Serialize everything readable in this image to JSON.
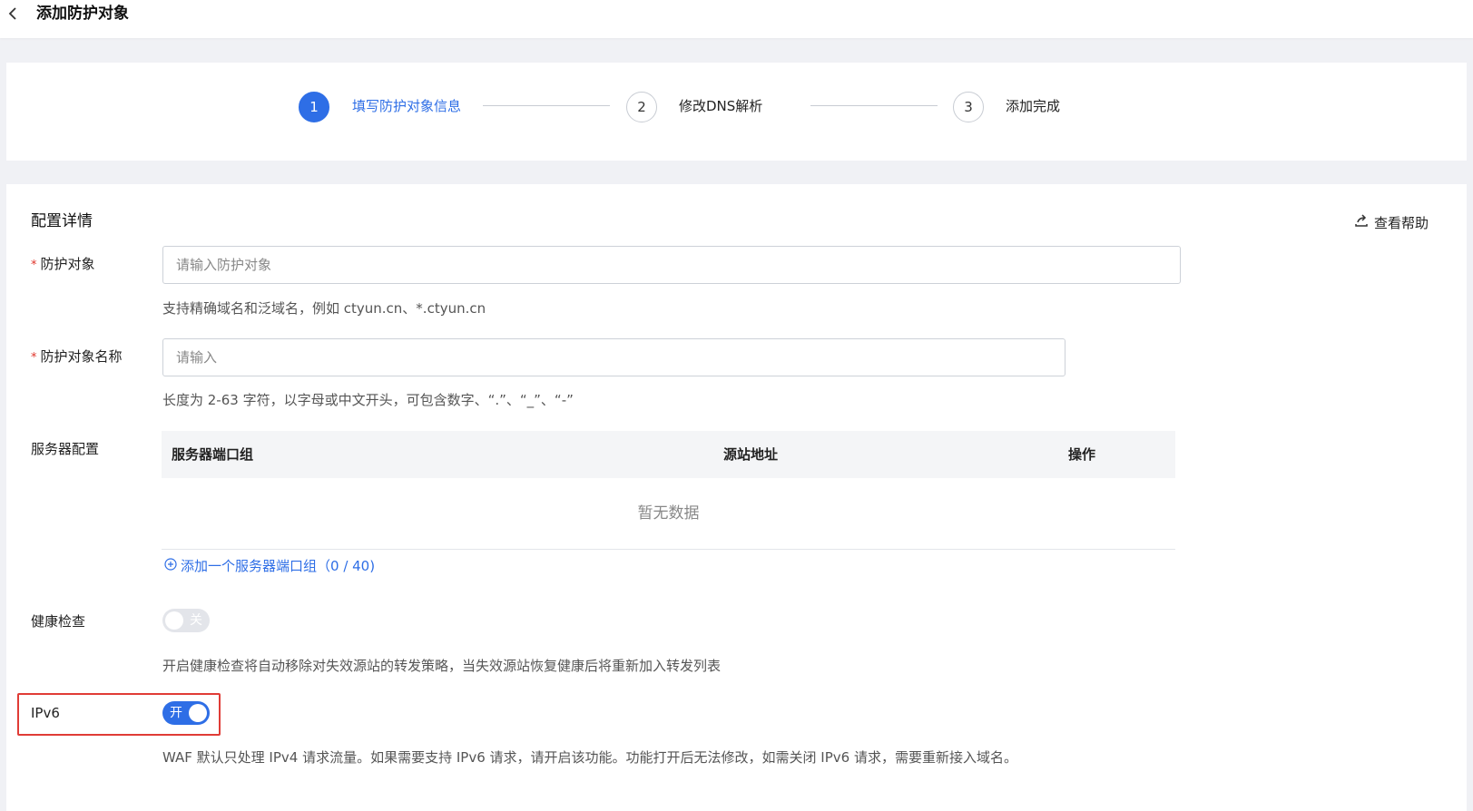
{
  "header": {
    "title": "添加防护对象"
  },
  "steps": [
    {
      "number": "1",
      "label": "填写防护对象信息",
      "state": "active"
    },
    {
      "number": "2",
      "label": "修改DNS解析",
      "state": "idle"
    },
    {
      "number": "3",
      "label": "添加完成",
      "state": "idle"
    }
  ],
  "form": {
    "section_title": "配置详情",
    "help_label": "查看帮助",
    "target": {
      "label": "防护对象",
      "placeholder": "请输入防护对象",
      "value": "",
      "hint": "支持精确域名和泛域名，例如 ctyun.cn、*.ctyun.cn"
    },
    "target_name": {
      "label": "防护对象名称",
      "placeholder": "请输入",
      "value": "",
      "hint": "长度为 2-63 字符，以字母或中文开头，可包含数字、“.”、“_”、“-”"
    },
    "server_config": {
      "label": "服务器配置",
      "columns": [
        "服务器端口组",
        "源站地址",
        "操作"
      ],
      "rows": [],
      "empty_text": "暂无数据",
      "add_label": "添加一个服务器端口组（0 / 40)",
      "count": 0,
      "max": 40
    },
    "health_check": {
      "label": "健康检查",
      "enabled": false,
      "switch_text": "关",
      "hint": "开启健康检查将自动移除对失效源站的转发策略，当失效源站恢复健康后将重新加入转发列表"
    },
    "ipv6": {
      "label": "IPv6",
      "enabled": true,
      "switch_text": "开",
      "hint": "WAF 默认只处理 IPv4 请求流量。如果需要支持 IPv6 请求，请开启该功能。功能打开后无法修改，如需关闭 IPv6 请求，需要重新接入域名。"
    }
  },
  "colors": {
    "accent": "#2e6ee6",
    "required": "#e0342a",
    "highlight": "#e03c36"
  }
}
